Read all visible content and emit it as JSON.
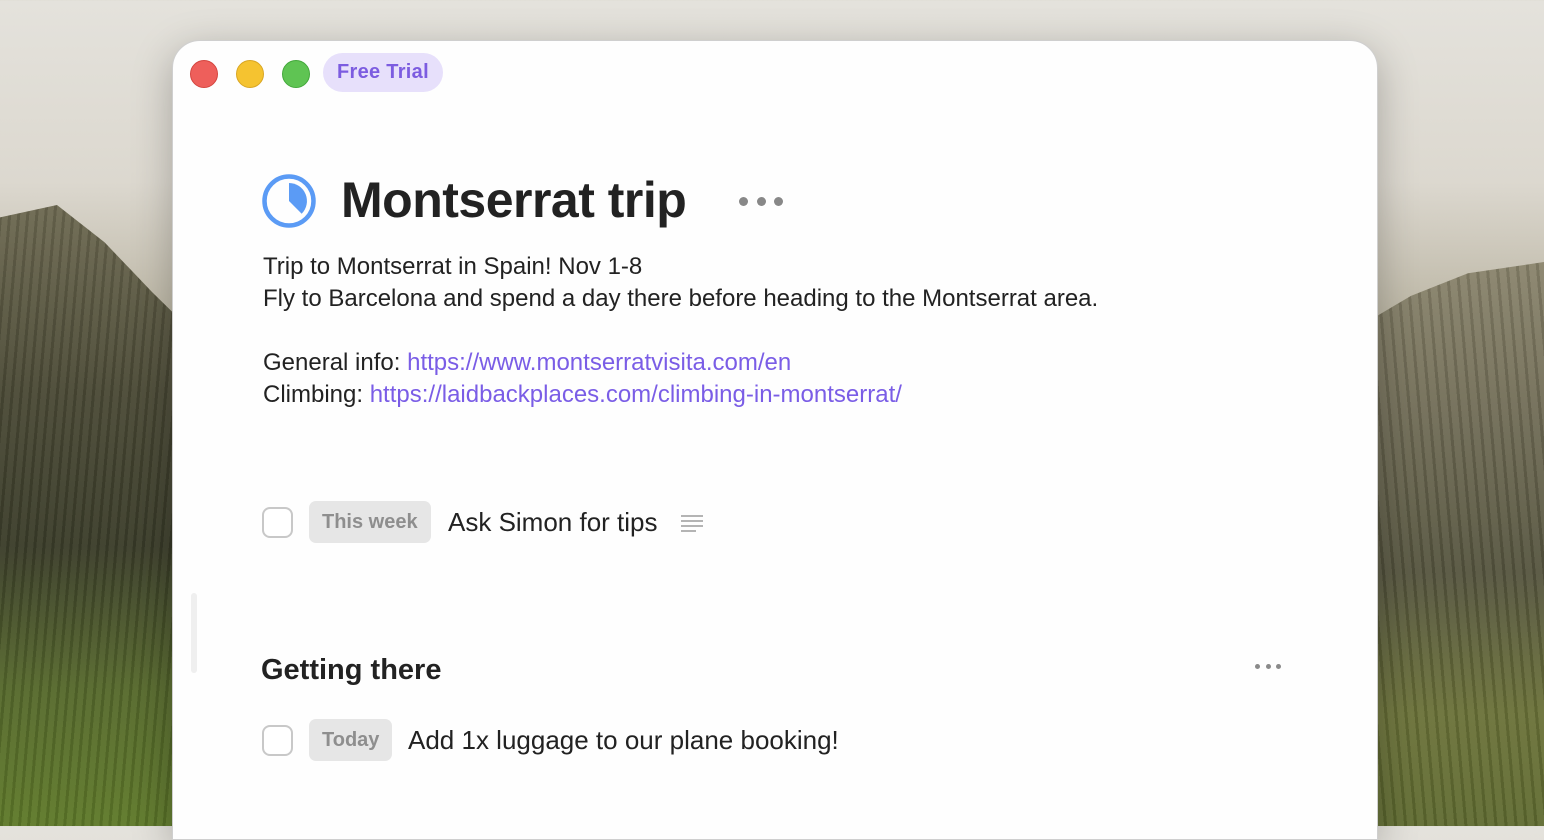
{
  "window": {
    "badge": "Free Trial"
  },
  "project": {
    "title": "Montserrat trip",
    "icon": "progress-pie-icon",
    "icon_color": "#5b9bf5",
    "notes": {
      "line1": "Trip to Montserrat in Spain! Nov 1-8",
      "line2": "Fly to Barcelona and spend a day there before heading to the Montserrat area.",
      "general_label": "General info: ",
      "general_link": "https://www.montserratvisita.com/en",
      "climbing_label": "Climbing: ",
      "climbing_link": "https://laidbackplaces.com/climbing-in-montserrat/"
    }
  },
  "tasks": [
    {
      "when": "This week",
      "title": "Ask Simon for tips",
      "has_notes": true
    }
  ],
  "headings": [
    {
      "title": "Getting there",
      "tasks": [
        {
          "when": "Today",
          "title": "Add 1x luggage to our plane booking!",
          "has_notes": false
        }
      ]
    }
  ],
  "colors": {
    "accent": "#7a5de6",
    "badge_bg": "#e7e0fb",
    "badge_text": "#7c5ce0",
    "close": "#ee5f5b",
    "minimize": "#f5c330",
    "maximize": "#5fc453"
  }
}
